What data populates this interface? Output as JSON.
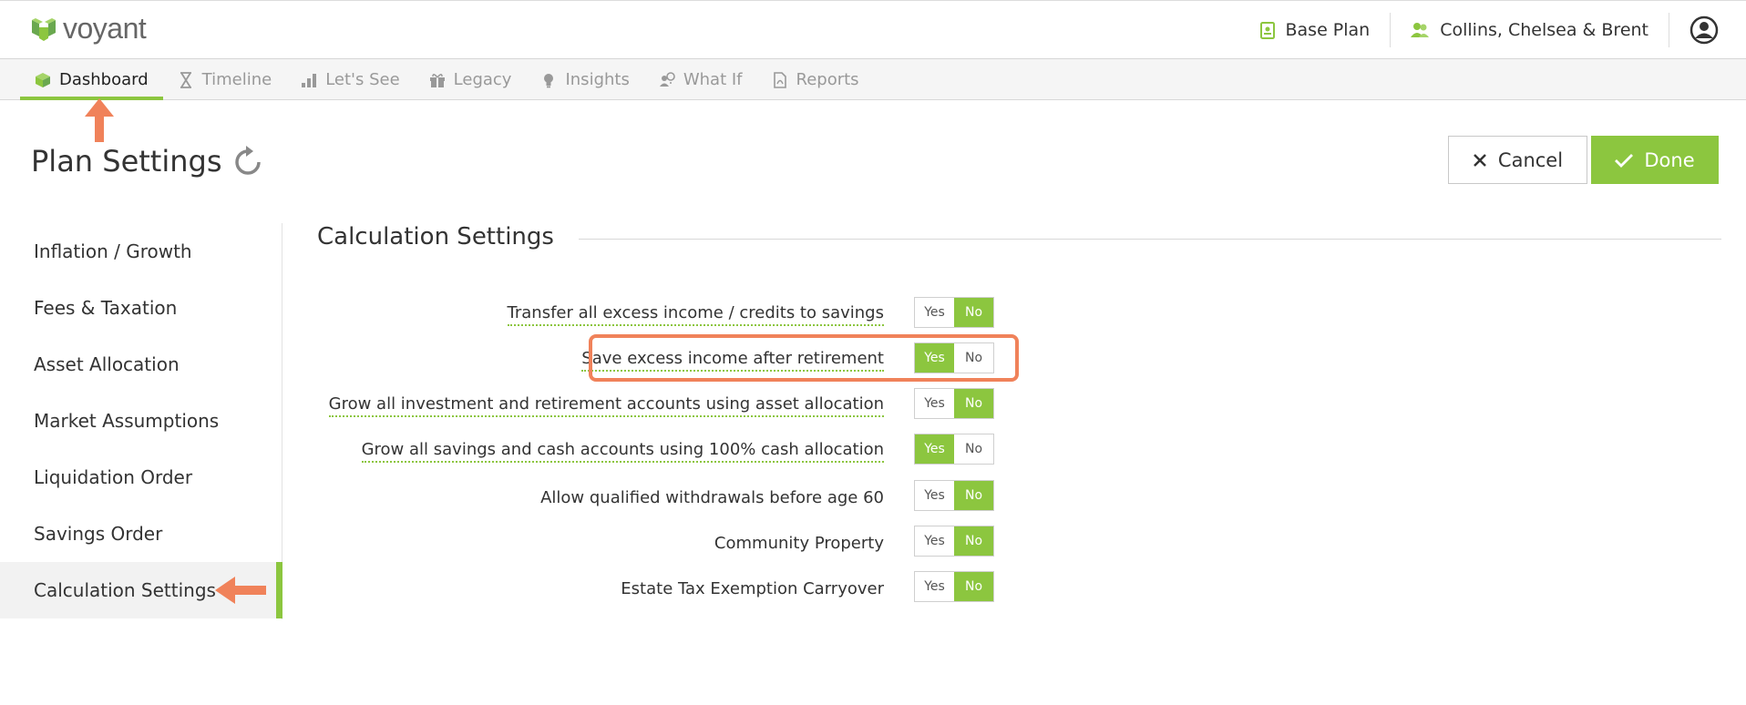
{
  "app": {
    "logo_text": "voyant"
  },
  "header": {
    "plan_label": "Base Plan",
    "client_label": "Collins, Chelsea & Brent"
  },
  "nav": {
    "items": [
      {
        "label": "Dashboard",
        "icon": "cube-icon",
        "active": true
      },
      {
        "label": "Timeline",
        "icon": "hourglass-icon"
      },
      {
        "label": "Let's See",
        "icon": "bar-chart-icon"
      },
      {
        "label": "Legacy",
        "icon": "gift-icon"
      },
      {
        "label": "Insights",
        "icon": "lightbulb-icon"
      },
      {
        "label": "What If",
        "icon": "people-question-icon"
      },
      {
        "label": "Reports",
        "icon": "pdf-document-icon"
      }
    ]
  },
  "page": {
    "title": "Plan Settings",
    "cancel_label": "Cancel",
    "done_label": "Done"
  },
  "sidebar": {
    "items": [
      {
        "label": "Inflation / Growth"
      },
      {
        "label": "Fees & Taxation"
      },
      {
        "label": "Asset Allocation"
      },
      {
        "label": "Market Assumptions"
      },
      {
        "label": "Liquidation Order"
      },
      {
        "label": "Savings Order"
      },
      {
        "label": "Calculation Settings",
        "active": true
      }
    ]
  },
  "main": {
    "section_title": "Calculation Settings",
    "yes_label": "Yes",
    "no_label": "No",
    "settings": [
      {
        "label": "Transfer all excess income / credits to savings",
        "value": "No"
      },
      {
        "label": "Save excess income after retirement",
        "value": "Yes"
      },
      {
        "label": "Grow all investment and retirement accounts using asset allocation",
        "value": "No"
      },
      {
        "label": "Grow all savings and cash accounts using 100% cash allocation",
        "value": "Yes"
      },
      {
        "label": "Allow qualified withdrawals before age 60",
        "value": "No"
      },
      {
        "label": "Community Property",
        "value": "No"
      },
      {
        "label": "Estate Tax Exemption Carryover",
        "value": "No"
      }
    ]
  },
  "colors": {
    "accent": "#8cc63f",
    "annotation": "#f0825a"
  }
}
